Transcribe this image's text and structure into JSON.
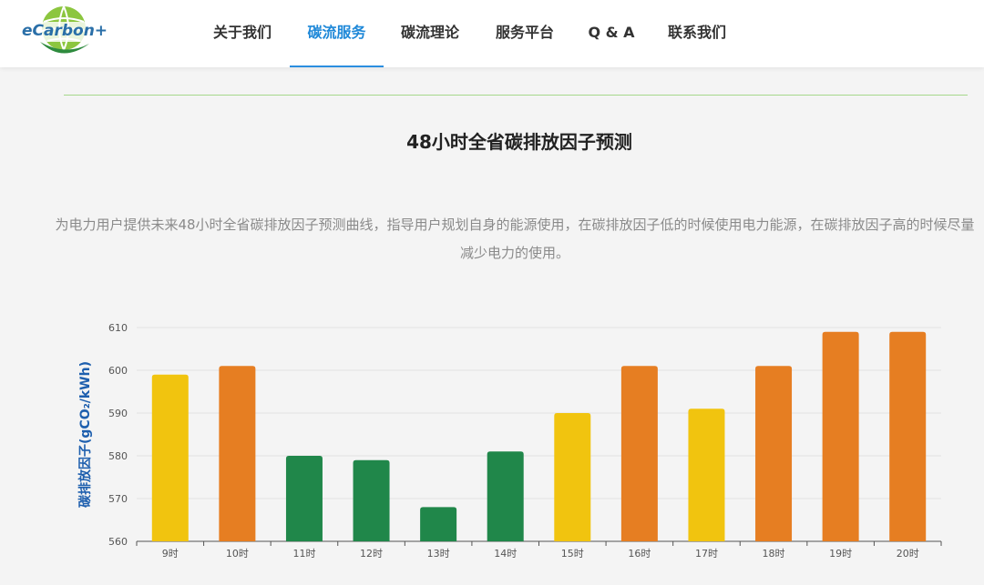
{
  "header": {
    "logo_text": "eCarbon+",
    "nav": [
      {
        "label": "关于我们",
        "active": false
      },
      {
        "label": "碳流服务",
        "active": true
      },
      {
        "label": "碳流理论",
        "active": false
      },
      {
        "label": "服务平台",
        "active": false
      },
      {
        "label": "Q & A",
        "active": false
      },
      {
        "label": "联系我们",
        "active": false
      }
    ]
  },
  "content": {
    "title": "48小时全省碳排放因子预测",
    "description": "为电力用户提供未来48小时全省碳排放因子预测曲线，指导用户规划自身的能源使用，在碳排放因子低的时候使用电力能源，在碳排放因子高的时候尽量减少电力的使用。"
  },
  "colors": {
    "accent": "#2b8ee0",
    "low": "#20874a",
    "mid": "#f1c40f",
    "high": "#e67e22"
  },
  "chart_data": {
    "type": "bar",
    "title": "",
    "xlabel": "",
    "ylabel": "碳排放因子(gCO₂/kWh)",
    "ylim": [
      560,
      610
    ],
    "yticks": [
      560,
      570,
      580,
      590,
      600,
      610
    ],
    "grid": true,
    "categories": [
      "9时",
      "10时",
      "11时",
      "12时",
      "13时",
      "14时",
      "15时",
      "16时",
      "17时",
      "18时",
      "19时",
      "20时"
    ],
    "values": [
      599,
      601,
      580,
      579,
      568,
      581,
      590,
      601,
      591,
      601,
      609,
      609
    ],
    "bar_levels": [
      "mid",
      "high",
      "low",
      "low",
      "low",
      "low",
      "mid",
      "high",
      "mid",
      "high",
      "high",
      "high"
    ]
  }
}
